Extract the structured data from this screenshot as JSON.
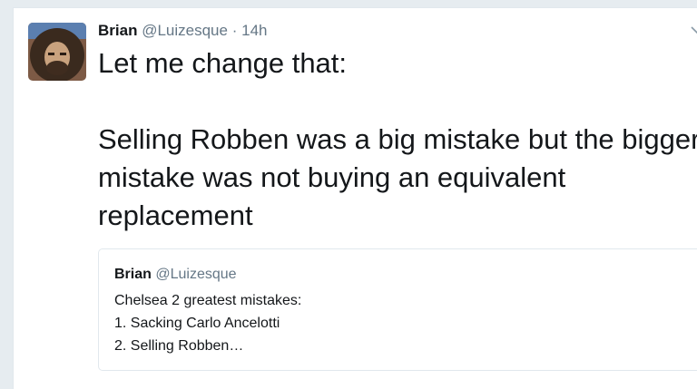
{
  "tweet": {
    "author_name": "Brian",
    "author_handle": "@Luizesque",
    "separator": "·",
    "timestamp": "14h",
    "text_lines": [
      "Let me change that:",
      "Selling Robben was a big mistake but the bigger mistake was not buying an equivalent replacement"
    ]
  },
  "quoted_tweet": {
    "author_name": "Brian",
    "author_handle": "@Luizesque",
    "lines": [
      "Chelsea 2 greatest mistakes:",
      "1. Sacking Carlo Ancelotti",
      "2. Selling Robben…"
    ]
  },
  "icons": {
    "caret": "chevron-down-icon",
    "avatar": "avatar-image"
  },
  "colors": {
    "text": "#14171a",
    "secondary": "#657786",
    "border": "#e1e8ed",
    "background": "#e6ecf0"
  }
}
